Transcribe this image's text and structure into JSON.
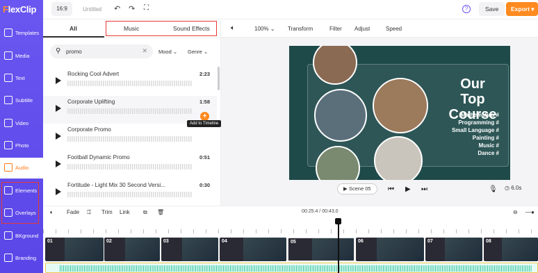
{
  "app": {
    "logo_text": "FlexClip",
    "title": "Untitled"
  },
  "topbar": {
    "ratio": "16:9",
    "save_label": "Save",
    "export_label": "Export"
  },
  "sidebar": {
    "items": [
      {
        "label": "Templates",
        "icon": "templates-icon"
      },
      {
        "label": "Media",
        "icon": "media-icon"
      },
      {
        "label": "Text",
        "icon": "text-icon"
      },
      {
        "label": "Subtitle",
        "icon": "subtitle-icon"
      },
      {
        "label": "Video",
        "icon": "video-icon"
      },
      {
        "label": "Photo",
        "icon": "photo-icon"
      },
      {
        "label": "Audio",
        "icon": "audio-icon",
        "active": true
      },
      {
        "label": "Elements",
        "icon": "elements-icon"
      },
      {
        "label": "Overlays",
        "icon": "overlays-icon"
      },
      {
        "label": "BKground",
        "icon": "background-icon"
      },
      {
        "label": "Branding",
        "icon": "branding-icon"
      }
    ]
  },
  "audio_panel": {
    "tabs": [
      "All",
      "Music",
      "Sound Effects"
    ],
    "active_tab": "All",
    "search": {
      "value": "promo",
      "placeholder": ""
    },
    "filters": [
      "Mood",
      "Genre"
    ],
    "tracks": [
      {
        "name": "Rocking Cool Advert",
        "duration": "2:23"
      },
      {
        "name": "Corporate Uplifting",
        "duration": "1:58"
      },
      {
        "name": "Corporate Promo",
        "duration": ""
      },
      {
        "name": "Football Dynamic Promo",
        "duration": "0:51"
      },
      {
        "name": "Fortitude - Light Mix 30 Second Versi...",
        "duration": "0:30"
      }
    ],
    "tooltip": "Add to Timeline"
  },
  "toolbar": {
    "zoom": "100%",
    "items": [
      "Transform",
      "Filter",
      "Adjust",
      "Speed"
    ]
  },
  "preview": {
    "title_line1": "Our Top",
    "title_line2": "Course",
    "subjects": [
      "Mathematics #",
      "Programming #",
      "Small Language #",
      "Painting #",
      "Music #",
      "Dance #"
    ]
  },
  "player": {
    "scene_label": "Scene",
    "scene_number": "05",
    "duration": "6.0s"
  },
  "timeline_toolbar": {
    "items": [
      "Fade",
      "Trim",
      "Link"
    ],
    "current_time": "00:25.4",
    "total_time": "00:43.0"
  },
  "timeline": {
    "clips": [
      "01",
      "02",
      "03",
      "04",
      "05",
      "06",
      "07",
      "08"
    ]
  },
  "colors": {
    "sidebar": "#5a46e8",
    "accent": "#ff8a1f",
    "highlight_box": "#e53935",
    "audio_wave": "#2fc6a0"
  }
}
